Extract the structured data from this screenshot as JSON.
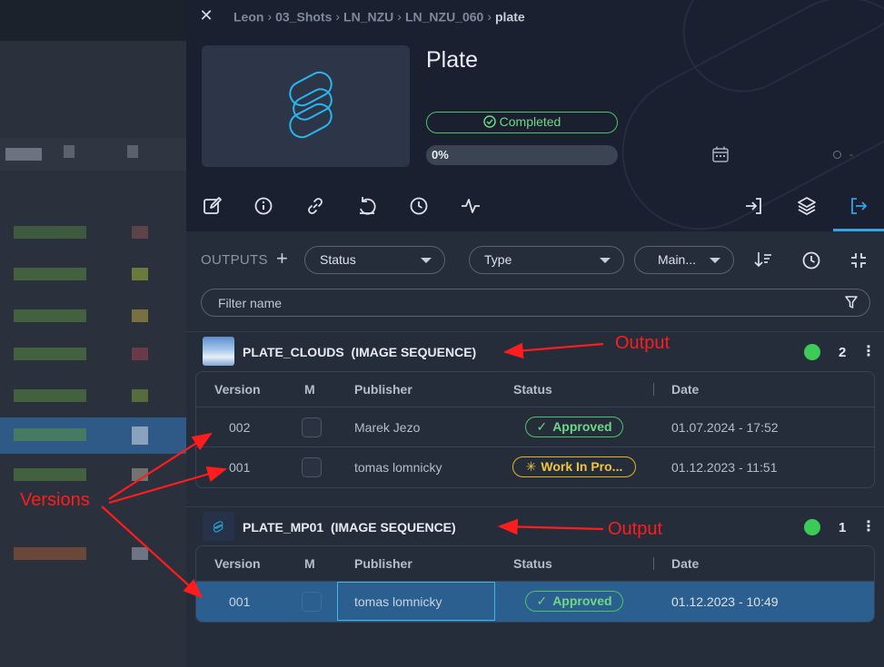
{
  "breadcrumb": [
    "Leon",
    "03_Shots",
    "LN_NZU",
    "LN_NZU_060",
    "plate"
  ],
  "entity": {
    "title": "Plate",
    "status": "Completed",
    "progress": 0,
    "progress_label": "0%",
    "date_placeholder": "-"
  },
  "outputs_bar": {
    "label": "OUTPUTS",
    "add": "+",
    "filters": [
      {
        "label": "Status"
      },
      {
        "label": "Type"
      },
      {
        "label": "Main..."
      }
    ],
    "filter_placeholder": "Filter name"
  },
  "columns": [
    "Version",
    "M",
    "Publisher",
    "Status",
    "Date"
  ],
  "groups": [
    {
      "name": "PLATE_CLOUDS",
      "type": "(IMAGE SEQUENCE)",
      "count": "2",
      "rows": [
        {
          "version": "002",
          "publisher": "Marek Jezo",
          "status": "Approved",
          "status_kind": "ok",
          "date": "01.07.2024 - 17:52"
        },
        {
          "version": "001",
          "publisher": "tomas lomnicky",
          "status": "Work In Pro...",
          "status_kind": "wip",
          "date": "01.12.2023 - 11:51"
        }
      ]
    },
    {
      "name": "PLATE_MP01",
      "type": "(IMAGE SEQUENCE)",
      "count": "1",
      "rows": [
        {
          "version": "001",
          "publisher": "tomas lomnicky",
          "status": "Approved",
          "status_kind": "ok",
          "date": "01.12.2023 - 10:49"
        }
      ]
    }
  ],
  "annotations": {
    "output_1": "Output",
    "output_2": "Output",
    "versions": "Versions"
  },
  "colors": {
    "accent": "#32a3e6",
    "approved": "#4ec36a",
    "wip": "#e6b422",
    "annotation": "#ff1c1c"
  }
}
